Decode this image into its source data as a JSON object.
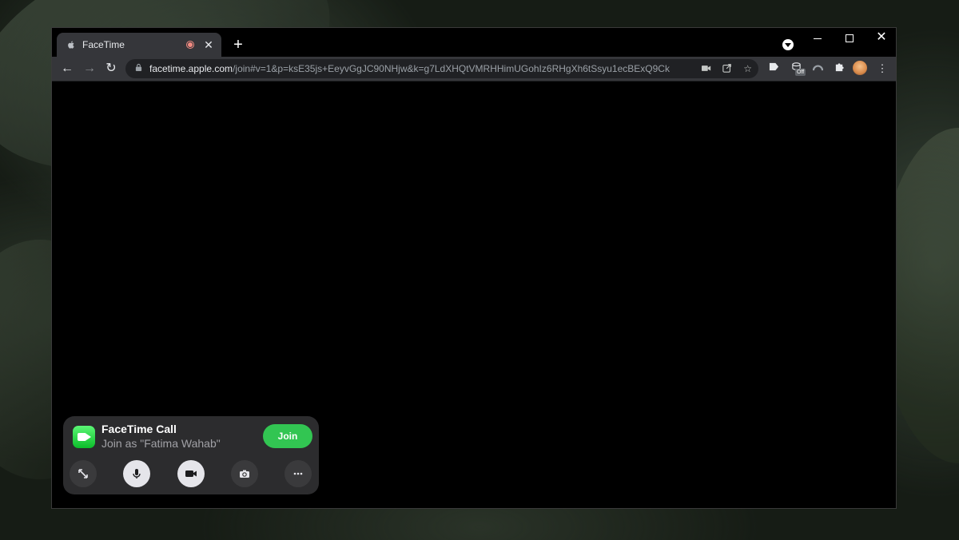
{
  "browser": {
    "tab_title": "FaceTime",
    "url_host": "facetime.apple.com",
    "url_path": "/join#v=1&p=ksE35js+EeyvGgJC90NHjw&k=g7LdXHQtVMRHHimUGohIz6RHgXh6tSsyu1ecBExQ9Ck",
    "new_tab_label": "+",
    "extension_badge": "Off"
  },
  "facetime": {
    "title": "FaceTime Call",
    "subtitle": "Join as \"Fatima Wahab\"",
    "join_label": "Join",
    "controls": [
      "expand-icon",
      "microphone-icon",
      "video-camera-icon",
      "camera-flip-icon",
      "more-icon"
    ]
  },
  "colors": {
    "join_green": "#32c552",
    "panel_bg": "#2c2c2e",
    "tab_bg": "#35363a"
  }
}
